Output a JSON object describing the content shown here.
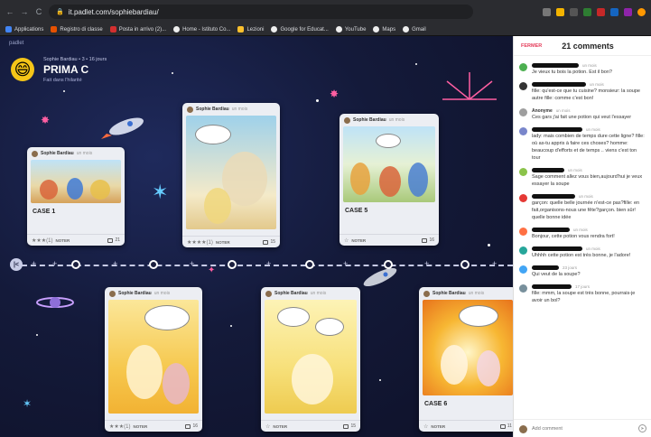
{
  "browser": {
    "url": "it.padlet.com/sophiebardiau/",
    "bookmarks": [
      "Applications",
      "Registro di classe",
      "Posta in arrivo (2)...",
      "Home - Istituto Co...",
      "Lezioni",
      "Google for Educat...",
      "YouTube",
      "Maps",
      "Gmail"
    ]
  },
  "board": {
    "brand": "padlet",
    "author_line": "Sophie Bardiau • 3 • 16 jours",
    "title": "PRIMA C",
    "subtitle": "Fait dans l'hilarité"
  },
  "cards": [
    {
      "author": "Sophie Bardiau",
      "age": "un mois",
      "title": "CASE 1",
      "rating": "★★★(1)",
      "noter": "NOTER",
      "comments": "21"
    },
    {
      "author": "Sophie Bardiau",
      "age": "un mois",
      "title": "",
      "rating": "★★★★(1)",
      "noter": "NOTER",
      "comments": "15"
    },
    {
      "author": "Sophie Bardiau",
      "age": "un mois",
      "title": "CASE 5",
      "rating": "☆",
      "noter": "NOTER",
      "comments": "16"
    },
    {
      "author": "Sophie Bardiau",
      "age": "un mois",
      "title": "",
      "rating": "★★★(1)",
      "noter": "NOTER",
      "comments": "16"
    },
    {
      "author": "Sophie Bardiau",
      "age": "un mois",
      "title": "",
      "rating": "☆",
      "noter": "NOTER",
      "comments": "15"
    },
    {
      "author": "Sophie Bardiau",
      "age": "un mois",
      "title": "CASE 6",
      "rating": "☆",
      "noter": "NOTER",
      "comments": "11"
    }
  ],
  "comments_panel": {
    "close_label": "FERMER",
    "title": "21 comments",
    "add_placeholder": "Add comment",
    "comments": [
      {
        "name": "",
        "time": "un mois",
        "text": "Je vieux tu bois la potion. Est il bon?",
        "color": "#4caf50"
      },
      {
        "name": "",
        "time": "un mois",
        "text": "fille: qu'est-ce que tu cuisine? monsieur: la soupe autre fille: comme c'est bon!",
        "color": "#333333"
      },
      {
        "name": "Anonyme",
        "time": "un mois",
        "text": "Ces gars j'ai fait une potion qui veut l'essayer",
        "color": "#9e9e9e"
      },
      {
        "name": "",
        "time": "un mois",
        "text": "lady: mais combien de temps dure cette ligne? fille: où as-tu appris à faire ces choses? homme: beaucoup d'efforts et de temps .. viens c'est ton tour",
        "color": "#7986cb"
      },
      {
        "name": "",
        "time": "un mois",
        "text": "Sage comment allez vous bien,aujourd'hui je veux essayer la soupe",
        "color": "#8bc34a"
      },
      {
        "name": "",
        "time": "un mois",
        "text": "garçon: quelle belle journée n'est-ce pas?fille: en fait,organisons-nous une fête?garçon. bien sûr! quelle bonne idée",
        "color": "#e53935"
      },
      {
        "name": "",
        "time": "un mois",
        "text": "Bonjour, cette potion vous rendra fort!",
        "color": "#ff7043"
      },
      {
        "name": "",
        "time": "un mois",
        "text": "Uhhhh cette potion est très bonne, je l'adore!",
        "color": "#26a69a"
      },
      {
        "name": "",
        "time": "23 jours",
        "text": "Qui veut de la soupe?",
        "color": "#42a5f5"
      },
      {
        "name": "",
        "time": "17 jours",
        "text": "fille: mmm, la soupe est très bonne, pourrais-je avoir un bol?",
        "color": "#78909c"
      }
    ]
  }
}
